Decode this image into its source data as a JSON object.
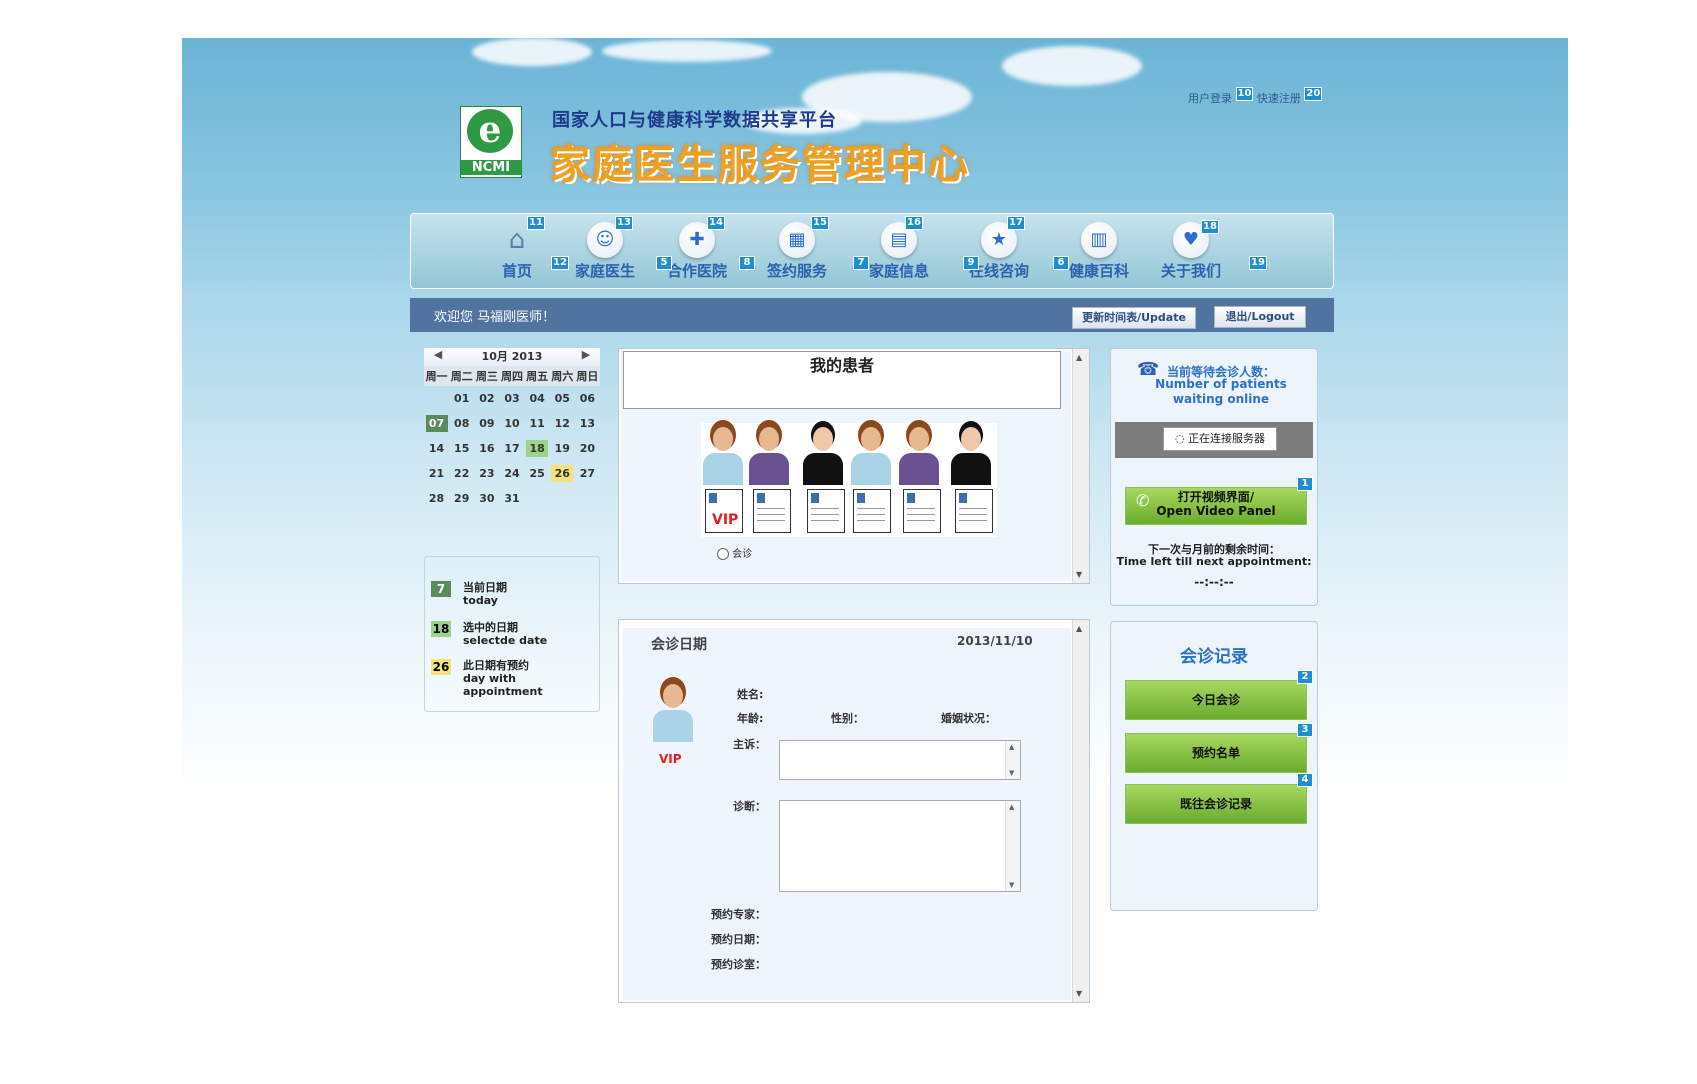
{
  "header": {
    "login_label": "用户登录",
    "login_badge": "10",
    "register_label": "快速注册",
    "register_badge": "20",
    "subtitle": "国家人口与健康科学数据共享平台",
    "title": "家庭医生服务管理中心",
    "logo_text": "NCMI",
    "logo_letter": "e"
  },
  "nav": {
    "items": [
      {
        "label": "首页",
        "badge": "11",
        "icon": "home-icon"
      },
      {
        "label": "家庭医生",
        "badge": "13",
        "icon": "doctor-icon"
      },
      {
        "label": "合作医院",
        "badge": "14",
        "icon": "hospital-icon"
      },
      {
        "label": "签约服务",
        "badge": "15",
        "icon": "calendar-icon"
      },
      {
        "label": "家庭信息",
        "badge": "16",
        "icon": "family-info-icon"
      },
      {
        "label": "在线咨询",
        "badge": "17",
        "icon": "star-consult-icon"
      },
      {
        "label": "健康百科",
        "badge": "",
        "icon": "book-icon"
      },
      {
        "label": "关于我们",
        "badge": "18",
        "icon": "handshake-icon"
      }
    ],
    "between_badges": [
      "12",
      "5",
      "8",
      "7",
      "9",
      "6",
      "19"
    ]
  },
  "welcome_bar": {
    "welcome_text": "欢迎您   马福刚医师！",
    "update_label": "更新时间表/Update",
    "logout_label": "退出/Logout"
  },
  "calendar": {
    "month_label": "10月  2013",
    "weekdays": [
      "周一",
      "周二",
      "周三",
      "周四",
      "周五",
      "周六",
      "周日"
    ],
    "weeks": [
      [
        "",
        "01",
        "02",
        "03",
        "04",
        "05",
        "06"
      ],
      [
        "07",
        "08",
        "09",
        "10",
        "11",
        "12",
        "13"
      ],
      [
        "14",
        "15",
        "16",
        "17",
        "18",
        "19",
        "20"
      ],
      [
        "21",
        "22",
        "23",
        "24",
        "25",
        "26",
        "27"
      ],
      [
        "28",
        "29",
        "30",
        "31",
        "",
        "",
        ""
      ]
    ],
    "today": "07",
    "selected": "18",
    "appointment": "26"
  },
  "legend": {
    "items": [
      {
        "num": "7",
        "cn": "当前日期",
        "en": "today",
        "color": "#5b8a5b"
      },
      {
        "num": "18",
        "cn": "选中的日期",
        "en": "selectde date",
        "color": "#9bd48a"
      },
      {
        "num": "26",
        "cn": "此日期有预约",
        "en": "day with appointment",
        "color": "#f6e27a"
      }
    ]
  },
  "patients": {
    "title": "我的患者",
    "vip_label": "VIP",
    "radio_label": "会诊"
  },
  "consult": {
    "date_label": "会诊日期",
    "date_value": "2013/11/10",
    "vip_label": "VIP",
    "name_label": "姓名:",
    "age_label": "年龄:",
    "gender_label": "性别：",
    "marital_label": "婚姻状况：",
    "complaint_label": "主诉：",
    "diagnosis_label": "诊断：",
    "expert_label": "预约专家：",
    "appt_date_label": "预约日期：",
    "room_label": "预约诊室："
  },
  "waiting": {
    "title_cn": "当前等待会诊人数：",
    "title_en": "Number of patients waiting online",
    "connecting": "正在连接服务器",
    "video_cn": "打开视频界面/",
    "video_en": "Open Video Panel",
    "video_badge": "1",
    "next_cn": "下一次与月前的剩余时间：",
    "next_en": "Time left till next appointment:",
    "timer": "--:--:--"
  },
  "records": {
    "title": "会诊记录",
    "buttons": [
      {
        "label": "今日会诊",
        "badge": "2"
      },
      {
        "label": "预约名单",
        "badge": "3"
      },
      {
        "label": "既往会诊记录",
        "badge": "4"
      }
    ]
  }
}
